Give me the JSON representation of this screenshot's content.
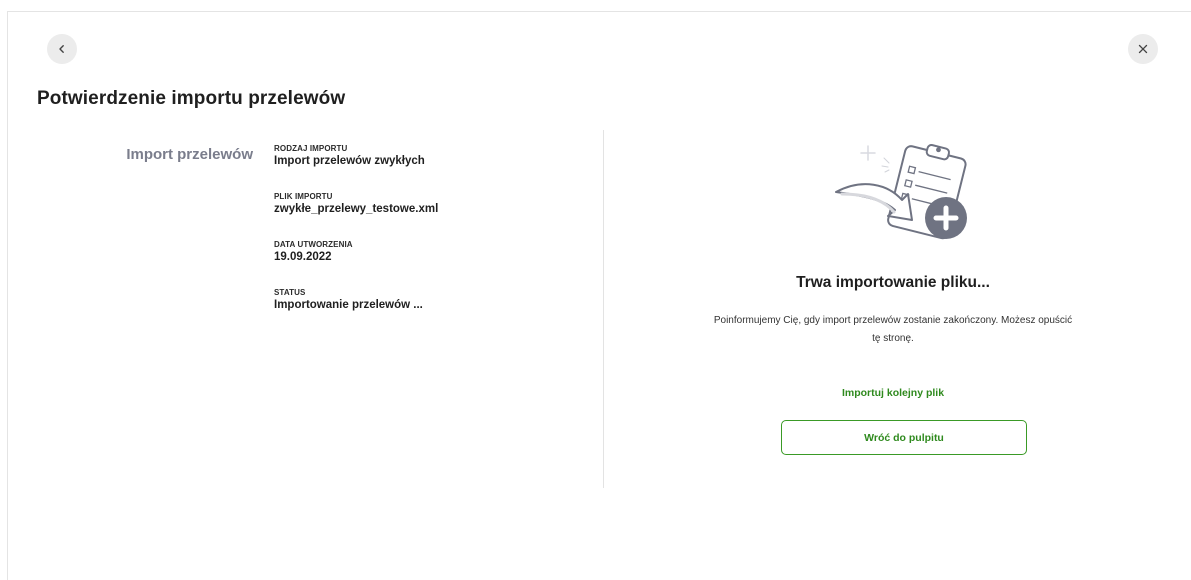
{
  "header": {
    "back_icon": "chevron-left-icon",
    "close_icon": "close-icon",
    "title": "Potwierdzenie importu przelewów"
  },
  "summary": {
    "section_label": "Import przelewów",
    "fields": [
      {
        "label": "RODZAJ IMPORTU",
        "value": "Import przelewów zwykłych"
      },
      {
        "label": "PLIK IMPORTU",
        "value": "zwykłe_przelewy_testowe.xml"
      },
      {
        "label": "DATA UTWORZENIA",
        "value": "19.09.2022"
      },
      {
        "label": "STATUS",
        "value": "Importowanie przelewów ..."
      }
    ]
  },
  "status_panel": {
    "illustration": "clipboard-import-illustration",
    "heading": "Trwa importowanie pliku...",
    "message": "Poinformujemy Cię, gdy import przelewów zostanie zakończony. Możesz opuścić tę stronę.",
    "import_next_label": "Importuj kolejny plik",
    "back_to_dashboard_label": "Wróć do pulpitu"
  },
  "colors": {
    "accent_green": "#2f8a1e",
    "section_label_gray": "#7a7d8c",
    "illustration_gray": "#6f7382"
  }
}
